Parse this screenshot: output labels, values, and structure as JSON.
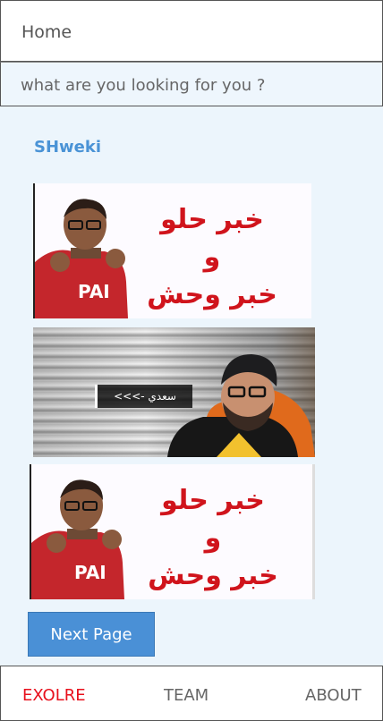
{
  "header": {
    "home_label": "Home"
  },
  "search": {
    "placeholder": "what are you looking for you ?"
  },
  "channel": {
    "name": "SHweki"
  },
  "videos": [
    {
      "title_lines": [
        "خبر حلو",
        "و",
        "خبر وحش"
      ]
    },
    {
      "subtitle": "سعدي ->>>"
    },
    {
      "title_lines": [
        "خبر حلو",
        "و",
        "خبر وحش"
      ]
    }
  ],
  "pagination": {
    "next_label": "Next Page"
  },
  "bottom_nav": {
    "items": [
      {
        "label": "EXOLRE",
        "active": true
      },
      {
        "label": "TEAM",
        "active": false
      },
      {
        "label": "ABOUT",
        "active": false
      }
    ]
  },
  "colors": {
    "accent": "#4a90d6",
    "active_nav": "#e8101c",
    "background": "#ecf5fc",
    "thumbnail_text": "#d0141c"
  }
}
